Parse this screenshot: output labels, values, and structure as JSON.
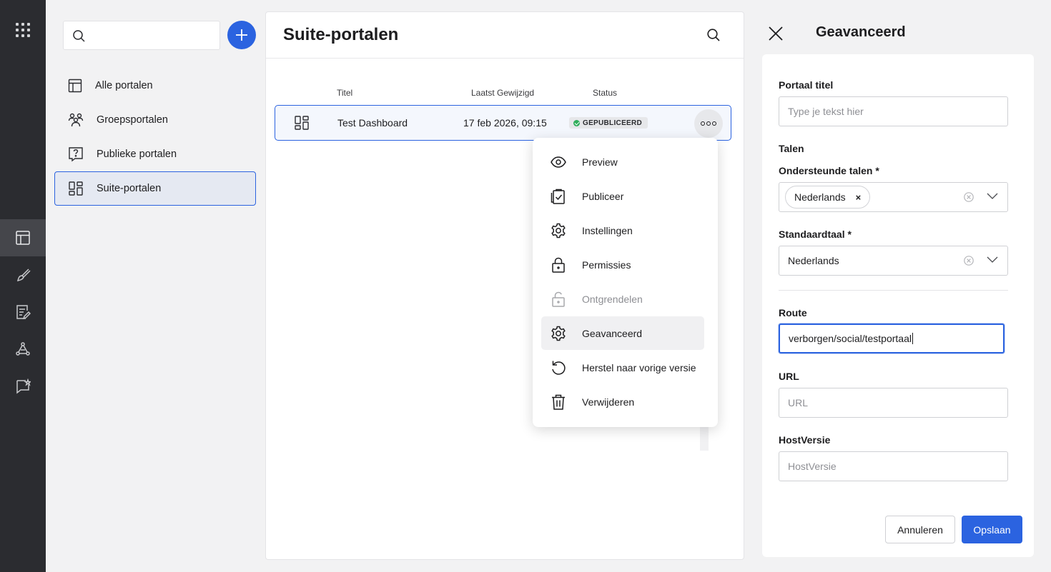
{
  "rail": {
    "items": [
      "apps-grid",
      "portals",
      "brush",
      "notes",
      "network",
      "feedback"
    ],
    "active": "portals"
  },
  "nav": {
    "search_placeholder": "",
    "items": [
      {
        "label": "Alle portalen",
        "icon": "layout-icon"
      },
      {
        "label": "Groepsportalen",
        "icon": "group-icon"
      },
      {
        "label": "Publieke portalen",
        "icon": "question-board-icon"
      },
      {
        "label": "Suite-portalen",
        "icon": "dashboard-icon",
        "active": true
      }
    ]
  },
  "main": {
    "title": "Suite-portalen",
    "columns": [
      "Titel",
      "Laatst Gewijzigd",
      "Status"
    ],
    "rows": [
      {
        "title": "Test Dashboard",
        "modified": "17 feb 2026, 09:15",
        "status": "GEPUBLICEERD"
      }
    ]
  },
  "menu": {
    "items": [
      {
        "label": "Preview",
        "icon": "eye-icon"
      },
      {
        "label": "Publiceer",
        "icon": "publish-icon"
      },
      {
        "label": "Instellingen",
        "icon": "gear-icon"
      },
      {
        "label": "Permissies",
        "icon": "lock-icon"
      },
      {
        "label": "Ontgrendelen",
        "icon": "unlock-icon",
        "disabled": true
      },
      {
        "label": "Geavanceerd",
        "icon": "gear-icon",
        "hover": true
      },
      {
        "label": "Herstel naar vorige versie",
        "icon": "restore-icon"
      },
      {
        "label": "Verwijderen",
        "icon": "trash-icon"
      }
    ]
  },
  "panel": {
    "title": "Geavanceerd",
    "portal_title_label": "Portaal titel",
    "portal_title_placeholder": "Type je tekst hier",
    "languages_heading": "Talen",
    "supported_label": "Ondersteunde talen *",
    "supported_chip": "Nederlands",
    "chip_remove": "×",
    "default_label": "Standaardtaal *",
    "default_value": "Nederlands",
    "route_label": "Route",
    "route_value": "verborgen/social/testportaal",
    "url_label": "URL",
    "url_placeholder": "URL",
    "host_label": "HostVersie",
    "host_placeholder": "HostVersie",
    "cancel": "Annuleren",
    "save": "Opslaan"
  },
  "colors": {
    "accent": "#2b63e0",
    "rail": "#2b2c30",
    "success": "#2fae5b"
  }
}
